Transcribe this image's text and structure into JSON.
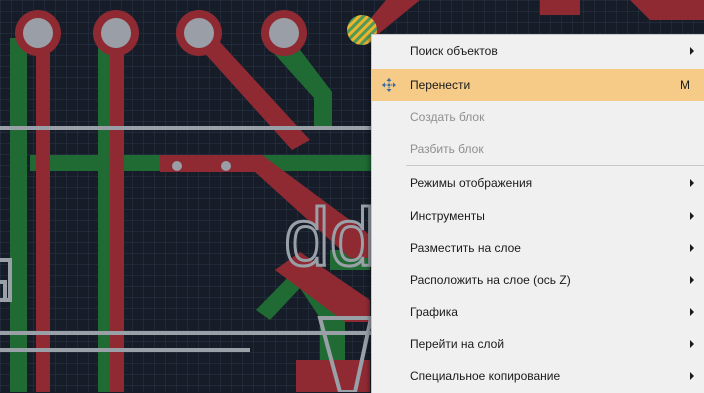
{
  "menu": {
    "items": [
      {
        "label": "Поиск объектов",
        "submenu": true,
        "disabled": false
      },
      {
        "label": "Перенести",
        "shortcut": "M",
        "icon": "move-icon",
        "highlighted": true,
        "disabled": false
      },
      {
        "label": "Создать блок",
        "disabled": true
      },
      {
        "label": "Разбить блок",
        "disabled": true
      },
      {
        "label": "Режимы отображения",
        "submenu": true,
        "disabled": false
      },
      {
        "label": "Инструменты",
        "submenu": true,
        "disabled": false
      },
      {
        "label": "Разместить на слое",
        "submenu": true,
        "disabled": false
      },
      {
        "label": "Расположить на слое (ось Z)",
        "submenu": true,
        "disabled": false
      },
      {
        "label": "Графика",
        "submenu": true,
        "disabled": false
      },
      {
        "label": "Перейти на слой",
        "submenu": true,
        "disabled": false
      },
      {
        "label": "Специальное копирование",
        "submenu": true,
        "disabled": false
      }
    ]
  },
  "canvas": {
    "text": "dd"
  },
  "colors": {
    "background": "#161d29",
    "grid": "#2b3545",
    "trace_red": "#8f2a32",
    "trace_green": "#1f6b33",
    "pad_gray": "#9a9ea6",
    "silk_gray": "#9aa0a8",
    "highlight": "#f6cb88",
    "menu_bg": "#f0f0f0"
  }
}
